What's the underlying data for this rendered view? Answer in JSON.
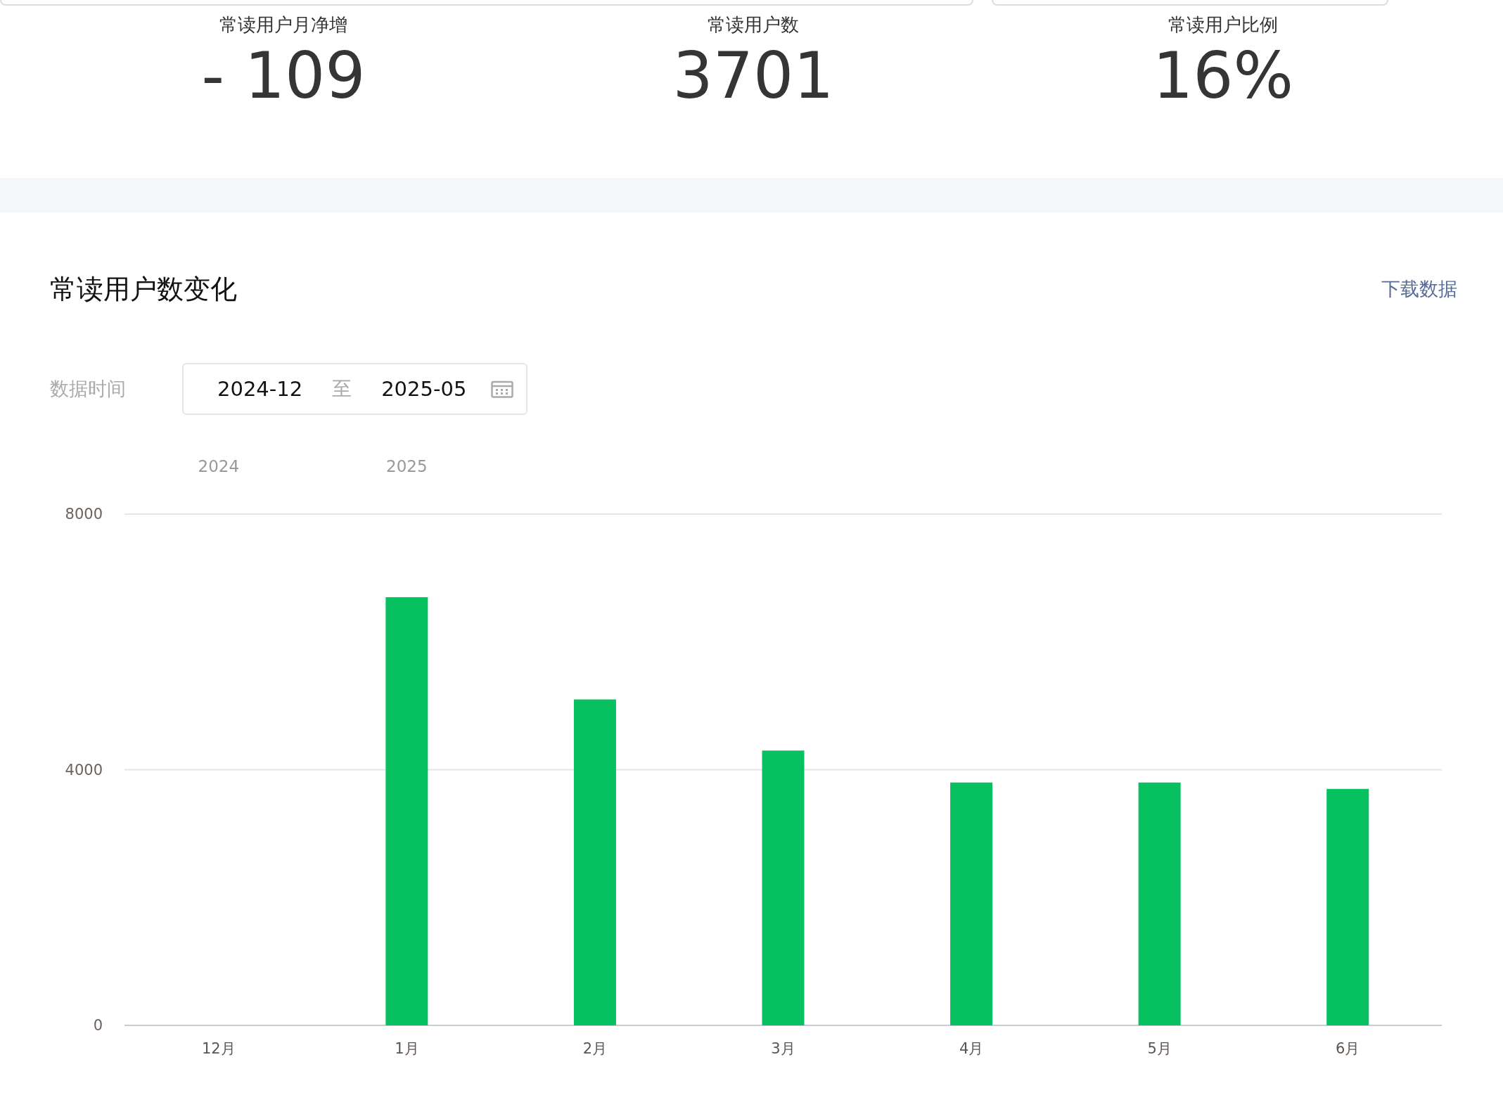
{
  "stats": [
    {
      "label": "常读用户月净增",
      "value": "- 109"
    },
    {
      "label": "常读用户数",
      "value": "3701"
    },
    {
      "label": "常读用户比例",
      "value": "16%"
    }
  ],
  "trend_panel": {
    "title": "常读用户数变化",
    "download_link": "下载数据",
    "date_filter": {
      "label": "数据时间",
      "start": "2024-12",
      "separator": "至",
      "end": "2025-05"
    },
    "chart_data": {
      "type": "bar",
      "categories": [
        "12月",
        "1月",
        "2月",
        "3月",
        "4月",
        "5月",
        "6月"
      ],
      "series": [
        {
          "color": "#07c160",
          "values": [
            0,
            6700,
            5100,
            4300,
            3800,
            3800,
            3700
          ]
        }
      ],
      "ylim": [
        0,
        8000
      ],
      "yticks": [
        0,
        4000,
        8000
      ],
      "annotations": [
        "2024",
        "2025"
      ]
    }
  }
}
